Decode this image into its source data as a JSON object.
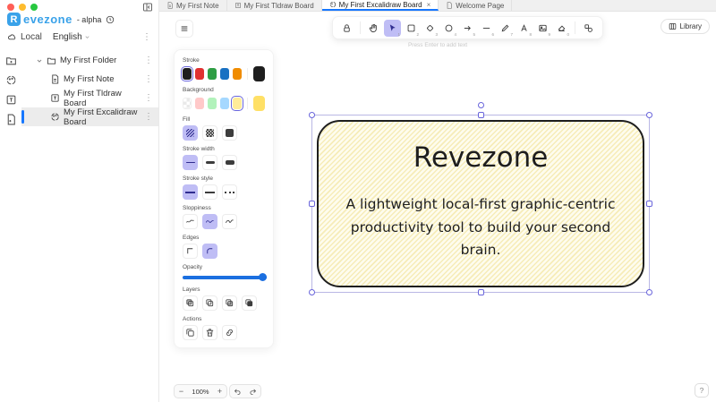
{
  "colors": {
    "accent_blue": "#1677ff",
    "logo_blue": "#3aa2e9",
    "tool_active_bg": "#bfbdf5",
    "selection_purple": "#6965db",
    "opacity_slider_blue": "#1b6fe0",
    "traffic_lights": [
      "#ff5f57",
      "#febc2e",
      "#28c840"
    ]
  },
  "sidebar": {
    "logo": {
      "letter": "R",
      "name": "evezone",
      "suffix": "- alpha"
    },
    "storage_label": "Local",
    "language_label": "English",
    "tree": {
      "folder_label": "My First Folder",
      "items": [
        {
          "label": "My First Note"
        },
        {
          "label": "My First Tldraw Board"
        },
        {
          "label": "My First Excalidraw Board"
        }
      ]
    }
  },
  "tabs": [
    {
      "label": "My First Note"
    },
    {
      "label": "My First Tldraw Board"
    },
    {
      "label": "My First Excalidraw Board",
      "close": "×"
    },
    {
      "label": "Welcome Page"
    }
  ],
  "toolbar": {
    "hint": "Press Enter to add text",
    "library_label": "Library",
    "shortcuts": {
      "select": "1",
      "rectangle": "2",
      "diamond": "3",
      "ellipse": "4",
      "arrow": "5",
      "line": "6",
      "draw": "7",
      "text": "8",
      "image": "9",
      "eraser": "0"
    }
  },
  "panel": {
    "sections": {
      "stroke": "Stroke",
      "background": "Background",
      "fill": "Fill",
      "stroke_width": "Stroke width",
      "stroke_style": "Stroke style",
      "sloppiness": "Sloppiness",
      "edges": "Edges",
      "opacity": "Opacity",
      "layers": "Layers",
      "actions": "Actions"
    },
    "stroke_colors": [
      "#1e1e1e",
      "#e03131",
      "#2f9e44",
      "#1971c2",
      "#f08c00"
    ],
    "current_stroke": "#1e1e1e",
    "background_colors": [
      "transparent",
      "#ffc9c9",
      "#b2f2bb",
      "#a5d8ff",
      "#ffec99"
    ],
    "current_background": "#ffe066",
    "selected_background": "#ffec99",
    "opacity_value": 100
  },
  "canvas_shape": {
    "title": "Revezone",
    "subtitle": "A lightweight local-first graphic-centric productivity tool to build your second brain."
  },
  "footer": {
    "zoom_out": "−",
    "zoom_level": "100%",
    "zoom_in": "+",
    "help": "?"
  }
}
